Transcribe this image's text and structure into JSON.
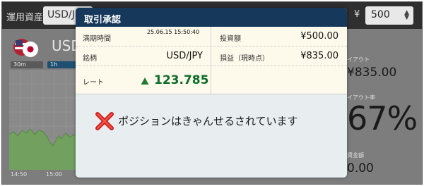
{
  "background": {
    "asset_label": "運用資産",
    "asset_select": "USD/J",
    "currency_symbol": "¥",
    "amount_select": "500",
    "pair_title": "USD",
    "timeframes": [
      "30m",
      "1h"
    ],
    "time_ticks": [
      "14:50",
      "15:00"
    ],
    "right_panel": {
      "payout_label": "イアウト",
      "payout_value": "¥835.00",
      "payout_rate_label": "イアウト率",
      "payout_rate_value": "67%",
      "amount_label": "資金額",
      "amount_value": "0.00"
    }
  },
  "modal": {
    "title": "取引承認",
    "expiry_label": "満期時間",
    "expiry_value": "25.06.15 15:50:40",
    "investment_label": "投資額",
    "investment_value": "¥500.00",
    "symbol_label": "銘柄",
    "symbol_value": "USD/JPY",
    "profit_label": "損益（現時点）",
    "profit_value": "¥835.00",
    "rate_label": "レート",
    "rate_direction_icon": "up-triangle-icon",
    "rate_value": "123.785",
    "message_icon": "red-x-icon",
    "message": "ポジションはきゃんせるされています"
  },
  "colors": {
    "header": "#16385a",
    "details_bg": "#fdf9eb",
    "rate_green": "#0d6b28",
    "x_red": "#d0201e"
  }
}
